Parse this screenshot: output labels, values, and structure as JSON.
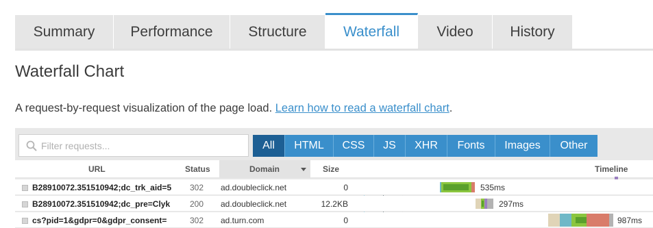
{
  "tabs": [
    {
      "label": "Summary",
      "active": false
    },
    {
      "label": "Performance",
      "active": false
    },
    {
      "label": "Structure",
      "active": false
    },
    {
      "label": "Waterfall",
      "active": true
    },
    {
      "label": "Video",
      "active": false
    },
    {
      "label": "History",
      "active": false
    }
  ],
  "page": {
    "title": "Waterfall Chart",
    "description": "A request-by-request visualization of the page load. ",
    "link_text": "Learn how to read a waterfall chart",
    "description_end": "."
  },
  "filter": {
    "search_placeholder": "Filter requests...",
    "types": [
      "All",
      "HTML",
      "CSS",
      "JS",
      "XHR",
      "Fonts",
      "Images",
      "Other"
    ],
    "active_type": "All"
  },
  "table": {
    "headers": {
      "url": "URL",
      "status": "Status",
      "domain": "Domain",
      "size": "Size",
      "timeline": "Timeline"
    },
    "sorted_by": "Domain",
    "rows": [
      {
        "url": "B28910072.351510942;dc_trk_aid=5",
        "status": "302",
        "domain": "ad.doubleclick.net",
        "size": "0",
        "timing": "535ms"
      },
      {
        "url": "B28910072.351510942;dc_pre=Clyk",
        "status": "200",
        "domain": "ad.doubleclick.net",
        "size": "12.2KB",
        "timing": "297ms"
      },
      {
        "url": "cs?pid=1&gdpr=0&gdpr_consent=",
        "status": "302",
        "domain": "ad.turn.com",
        "size": "0",
        "timing": "987ms"
      }
    ]
  },
  "colors": {
    "accent": "#3a8fcb",
    "active_filter": "#1d5f94",
    "dns": "#e0d4b7",
    "connect": "#8cc63f",
    "wait": "#5aa02c",
    "receive": "#b3b3b3",
    "ssl": "#d97c6a",
    "ttfb": "#6fb8c7"
  }
}
